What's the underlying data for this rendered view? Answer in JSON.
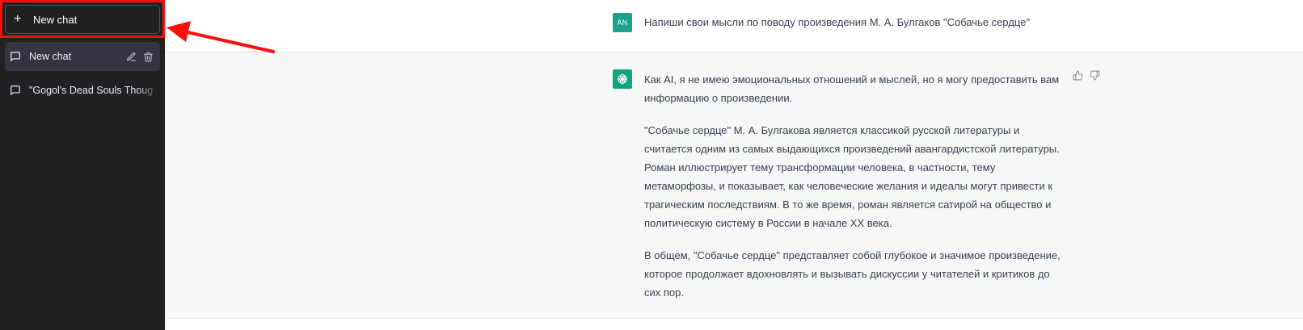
{
  "sidebar": {
    "new_chat_label": "New chat",
    "items": [
      {
        "label": "New chat",
        "active": true
      },
      {
        "label": "\"Gogol's Dead Souls Thought",
        "active": false
      }
    ]
  },
  "conversation": {
    "user": {
      "avatar_initials": "AN",
      "message": "Напиши свои мысли по поводу произведения М. А. Булгаков \"Собачье сердце\""
    },
    "assistant": {
      "paragraphs": [
        "Как AI, я не имею эмоциональных отношений и мыслей, но я могу предоставить вам информацию о произведении.",
        "\"Собачье сердце\" М. А. Булгакова является классикой русской литературы и считается одним из самых выдающихся произведений авангардистской литературы. Роман иллюстрирует тему трансформации человека, в частности, тему метаморфозы, и показывает, как человеческие желания и идеалы могут привести к трагическим последствиям. В то же время, роман является сатирой на общество и политическую систему в России в начале XX века.",
        "В общем, \"Собачье сердце\" представляет собой глубокое и значимое произведение, которое продолжает вдохновлять и вызывать дискуссии у читателей и критиков до сих пор."
      ]
    }
  },
  "icons": {
    "new_chat": "plus-icon",
    "chat_item": "message-bubble-icon",
    "edit": "pencil-icon",
    "delete": "trash-icon",
    "assistant_avatar": "openai-logo-icon",
    "like": "thumbs-up-icon",
    "dislike": "thumbs-down-icon"
  },
  "colors": {
    "sidebar_bg": "#202123",
    "active_item_bg": "#343541",
    "user_avatar": "#1aa187",
    "assistant_avatar": "#10a37f",
    "assistant_row_bg": "#f7f7f8",
    "annotation_red": "#ff0d0d"
  }
}
